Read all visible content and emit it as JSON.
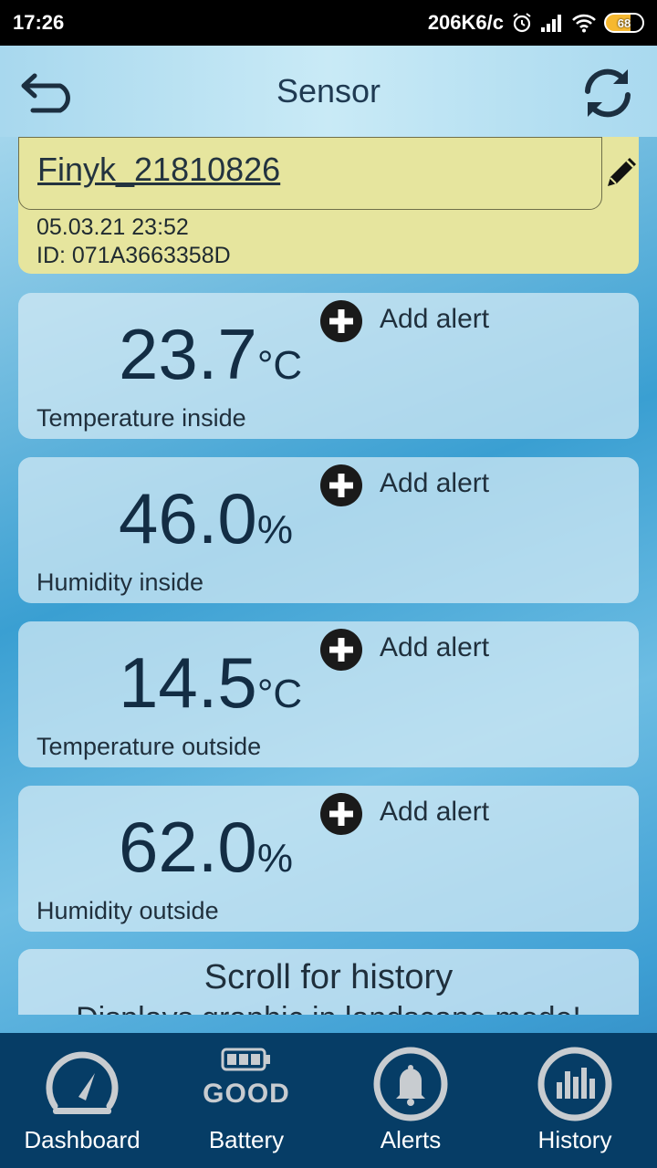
{
  "status_bar": {
    "time": "17:26",
    "speed": "206K6/c",
    "battery": "68"
  },
  "header": {
    "title": "Sensor"
  },
  "device": {
    "name": "Finyk_21810826",
    "datetime": "05.03.21  23:52",
    "id": "ID: 071A3663358D"
  },
  "sensors": [
    {
      "value": "23.7",
      "unit": "°C",
      "label": "Temperature inside",
      "alert": "Add alert"
    },
    {
      "value": "46.0",
      "unit": "%",
      "label": "Humidity inside",
      "alert": "Add alert"
    },
    {
      "value": "14.5",
      "unit": "°C",
      "label": "Temperature outside",
      "alert": "Add alert"
    },
    {
      "value": "62.0",
      "unit": "%",
      "label": "Humidity outside",
      "alert": "Add alert"
    }
  ],
  "info": {
    "scroll": "Scroll for history",
    "landscape": "Displays graphic in landscape mode!"
  },
  "nav": {
    "dashboard": "Dashboard",
    "battery": "Battery",
    "battery_status": "GOOD",
    "alerts": "Alerts",
    "history": "History"
  },
  "colors": {
    "nav_bg": "#063d66",
    "device_card": "#e6e59e",
    "text_dark": "#132d44"
  }
}
